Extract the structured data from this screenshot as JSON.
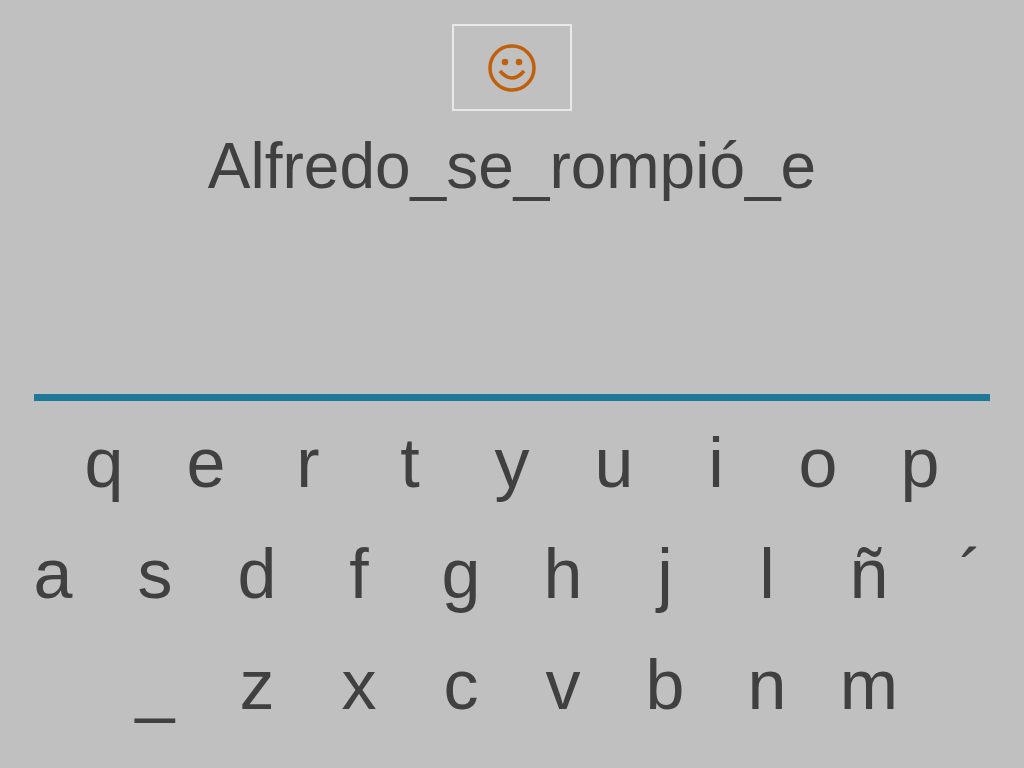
{
  "phrase": "Alfredo_se_rompió_e",
  "keyboard": {
    "rows": [
      [
        "q",
        "e",
        "r",
        "t",
        "y",
        "u",
        "i",
        "o",
        "p"
      ],
      [
        "a",
        "s",
        "d",
        "f",
        "g",
        "h",
        "j",
        "l",
        "ñ",
        "´"
      ],
      [
        "_",
        "z",
        "x",
        "c",
        "v",
        "b",
        "n",
        "m"
      ]
    ]
  }
}
